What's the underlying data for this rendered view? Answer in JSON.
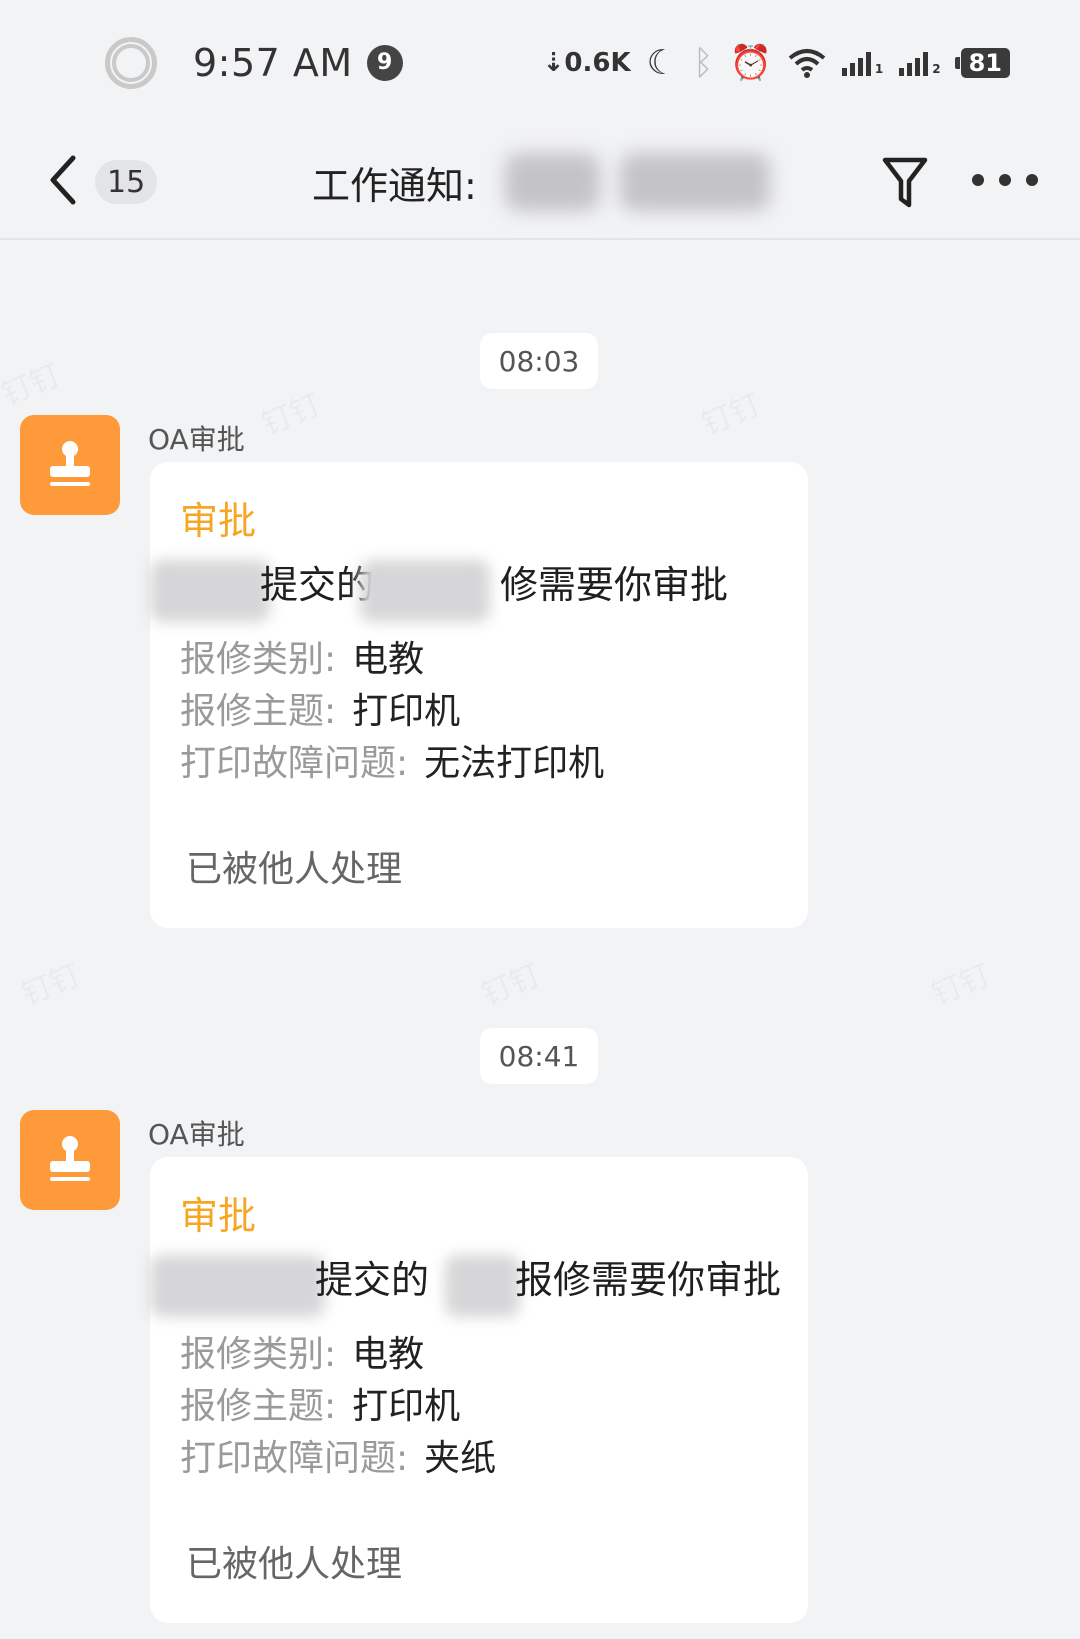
{
  "status_bar": {
    "time": "9:57 AM",
    "notification_count": "9",
    "net_speed": "⇣0.6K",
    "battery": "81",
    "sim1_label": "1",
    "sim2_label": "2"
  },
  "header": {
    "unread_count": "15",
    "title": "工作通知:"
  },
  "messages": [
    {
      "time": "08:03",
      "sender": "OA审批",
      "card": {
        "type": "审批",
        "summary": "提交的",
        "summary_tail": "修需要你审批",
        "fields": [
          {
            "label": "报修类别:",
            "value": "电教"
          },
          {
            "label": "报修主题:",
            "value": "打印机"
          },
          {
            "label": "打印故障问题:",
            "value": "无法打印机"
          }
        ],
        "status": "已被他人处理"
      }
    },
    {
      "time": "08:41",
      "sender": "OA审批",
      "card": {
        "type": "审批",
        "summary": "提交的",
        "summary_tail": "报修需要你审批",
        "fields": [
          {
            "label": "报修类别:",
            "value": "电教"
          },
          {
            "label": "报修主题:",
            "value": "打印机"
          },
          {
            "label": "打印故障问题:",
            "value": "夹纸"
          }
        ],
        "status": "已被他人处理"
      }
    }
  ],
  "colors": {
    "accent_orange": "#ff9a3b",
    "card_type": "#f5a623",
    "background": "#f2f3f5"
  },
  "icons": {
    "back": "chevron-left-icon",
    "filter": "filter-icon",
    "more": "more-dots-icon",
    "avatar": "stamp-icon"
  }
}
